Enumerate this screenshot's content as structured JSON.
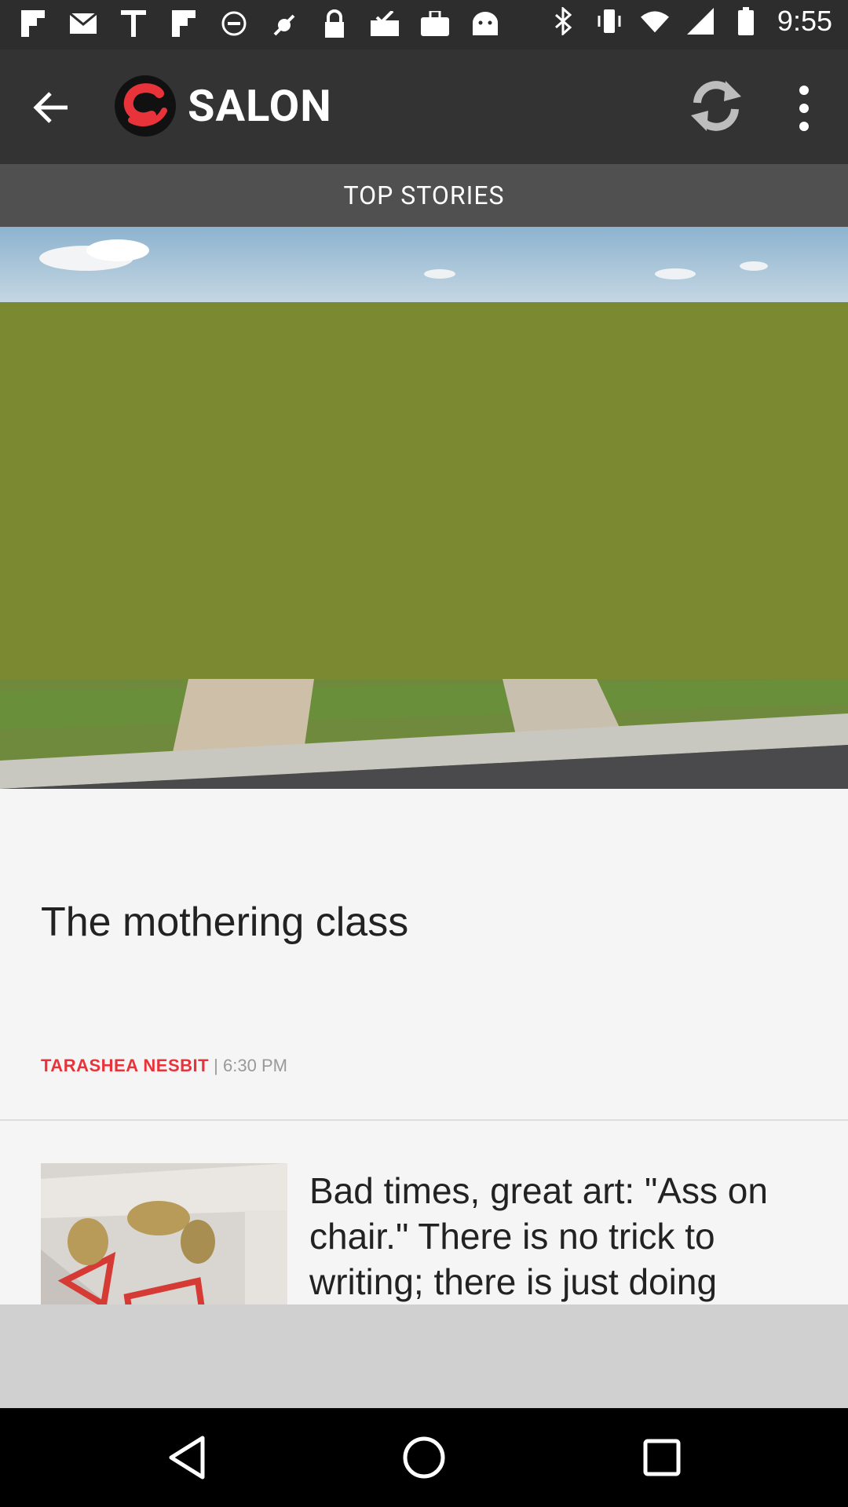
{
  "status_bar": {
    "time": "9:55",
    "left_icons": [
      "flipboard-icon",
      "gmail-icon",
      "text-icon",
      "flipboard-icon",
      "do-not-disturb-icon",
      "fake-gps-icon",
      "lock-icon",
      "inbox-check-icon",
      "briefcase-icon",
      "android-icon"
    ],
    "right_icons": [
      "bluetooth-icon",
      "vibrate-icon",
      "wifi-icon",
      "cellular-signal-icon",
      "battery-icon"
    ]
  },
  "app_bar": {
    "back_icon": "arrow-back-icon",
    "logo_text": "SALON",
    "logo_color": "#e8333b",
    "refresh_icon": "refresh-icon",
    "more_icon": "more-vert-icon"
  },
  "tab": {
    "label": "TOP STORIES"
  },
  "hero_article": {
    "headline": "The mothering class",
    "author": "TARASHEA NESBIT",
    "separator": " | ",
    "time": "6:30 PM",
    "accent_color": "#e8333b"
  },
  "list_article": {
    "title": "Bad times, great art: \"Ass on chair.\" There is no trick to writing; there is just doing"
  },
  "nav_bar": {
    "back_icon": "nav-back-icon",
    "home_icon": "nav-home-icon",
    "recents_icon": "nav-recents-icon"
  }
}
